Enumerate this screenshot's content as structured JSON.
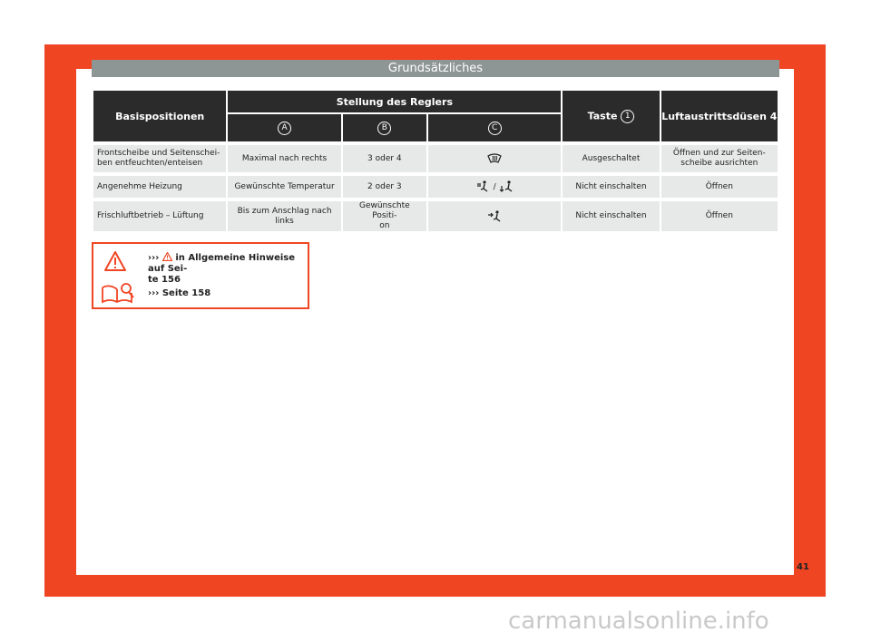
{
  "header": {
    "title": "Grundsätzliches"
  },
  "table": {
    "col_base": "Basispositionen",
    "col_stellung": "Stellung des Reglers",
    "col_taste": "Taste",
    "taste_num": "1",
    "col_luft": "Luftaustrittsdüsen 4",
    "sub": [
      "A",
      "B",
      "C"
    ],
    "rows": [
      {
        "base": "Frontscheibe und Seitenschei-\nben entfeuchten/enteisen",
        "a": "Maximal nach rechts",
        "b": "3 oder 4",
        "c_icon": "defrost-icon",
        "taste": "Ausgeschaltet",
        "luft": "Öffnen und zur Seiten-\nscheibe ausrichten"
      },
      {
        "base": "Angenehme Heizung",
        "a": "Gewünschte Temperatur",
        "b": "2 oder 3",
        "c_icon": "footwell-face-icon",
        "c_sep": "/",
        "taste": "Nicht einschalten",
        "luft": "Öffnen"
      },
      {
        "base": "Frischluftbetrieb – Lüftung",
        "a": "Bis zum Anschlag nach\nlinks",
        "b": "Gewünschte Positi-\non",
        "c_icon": "face-vent-icon",
        "taste": "Nicht einschalten",
        "luft": "Öffnen"
      }
    ]
  },
  "notes": {
    "warning_prefix": "›››",
    "warning_text": "in Allgemeine Hinweise auf Sei-\nte 156",
    "book_text": "››› Seite 158"
  },
  "page_number": "41",
  "footer": "carmanualsonline.info",
  "colors": {
    "accent": "#f04523",
    "header_bar": "#8e9595",
    "table_head": "#2b2b2b",
    "row_bg": "#e7e8e8"
  }
}
